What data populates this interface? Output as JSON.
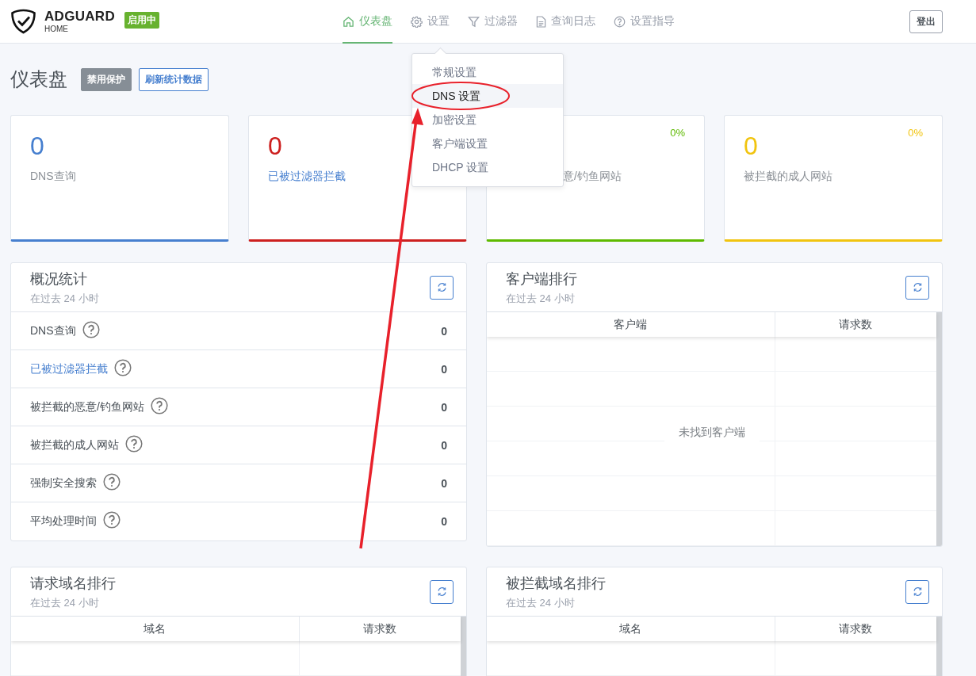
{
  "header": {
    "logo": {
      "name": "ADGUARD",
      "sub": "HOME"
    },
    "status_badge": "启用中",
    "nav": [
      {
        "label": "仪表盘",
        "selected": true
      },
      {
        "label": "设置",
        "selected": false
      },
      {
        "label": "过滤器",
        "selected": false
      },
      {
        "label": "查询日志",
        "selected": false
      },
      {
        "label": "设置指导",
        "selected": false
      }
    ],
    "logout": "登出"
  },
  "settings_menu": {
    "items": [
      {
        "label": "常规设置",
        "selected": false
      },
      {
        "label": "DNS 设置",
        "selected": true
      },
      {
        "label": "加密设置",
        "selected": false
      },
      {
        "label": "客户端设置",
        "selected": false
      },
      {
        "label": "DHCP 设置",
        "selected": false
      }
    ]
  },
  "page": {
    "title": "仪表盘",
    "buttons": [
      {
        "label": "禁用保护",
        "kind": "secondary"
      },
      {
        "label": "刷新统计数据",
        "kind": "outline"
      }
    ]
  },
  "stat_cards": [
    {
      "value": "0",
      "label": "DNS查询",
      "kind": "text",
      "color": "#467fcf"
    },
    {
      "value": "0",
      "label": "已被过滤器拦截",
      "kind": "link",
      "color": "#cd201f"
    },
    {
      "percent": "0%",
      "label": "意/钓鱼网站",
      "kind": "text",
      "color": "#5eba00"
    },
    {
      "value": "0",
      "percent": "0%",
      "label": "被拦截的成人网站",
      "kind": "text",
      "color": "#f1c40f"
    }
  ],
  "general_stats": {
    "title": "概况统计",
    "subtitle": "在过去 24 小时",
    "rows": [
      {
        "label": "DNS查询",
        "value": "0",
        "kind": "text"
      },
      {
        "label": "已被过滤器拦截",
        "value": "0",
        "kind": "link"
      },
      {
        "label": "被拦截的恶意/钓鱼网站",
        "value": "0",
        "kind": "text"
      },
      {
        "label": "被拦截的成人网站",
        "value": "0",
        "kind": "text"
      },
      {
        "label": "强制安全搜索",
        "value": "0",
        "kind": "text"
      },
      {
        "label": "平均处理时间",
        "value": "0",
        "kind": "text"
      }
    ]
  },
  "top_clients": {
    "title": "客户端排行",
    "subtitle": "在过去 24 小时",
    "columns": [
      "客户端",
      "请求数"
    ],
    "empty_text": "未找到客户端"
  },
  "top_queried": {
    "title": "请求域名排行",
    "subtitle": "在过去 24 小时",
    "columns": [
      "域名",
      "请求数"
    ]
  },
  "top_blocked": {
    "title": "被拦截域名排行",
    "subtitle": "在过去 24 小时",
    "columns": [
      "域名",
      "请求数"
    ]
  }
}
